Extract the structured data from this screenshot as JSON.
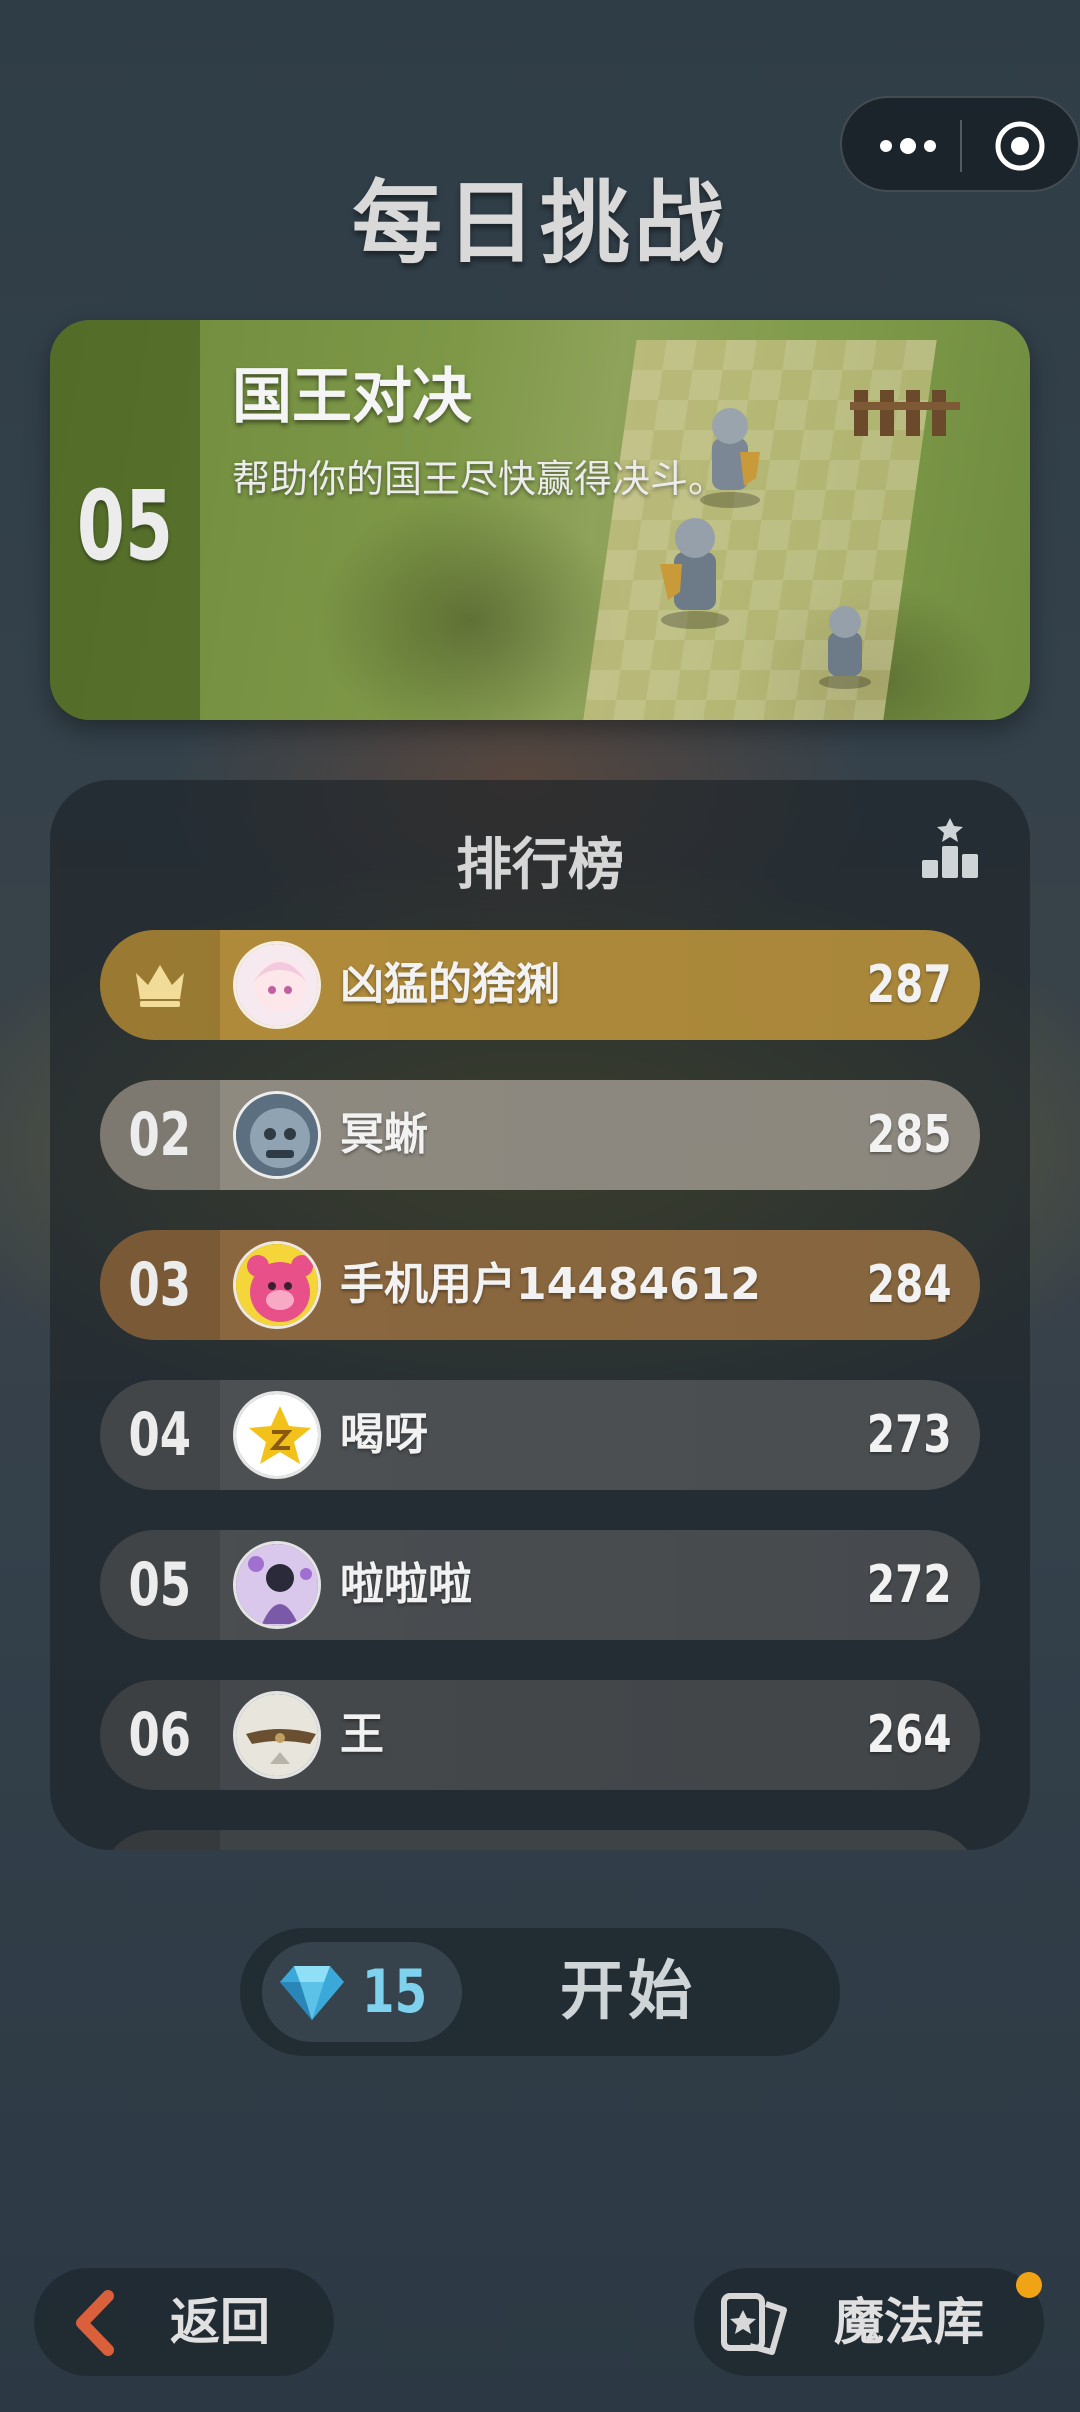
{
  "header": {
    "title": "每日挑战"
  },
  "challenge": {
    "number": "05",
    "name": "国王对决",
    "description": "帮助你的国王尽快赢得决斗。"
  },
  "leaderboard": {
    "title": "排行榜",
    "rows": [
      {
        "rank": "",
        "name": "凶猛的猞猁",
        "score": "287"
      },
      {
        "rank": "02",
        "name": "冥蜥",
        "score": "285"
      },
      {
        "rank": "03",
        "name": "手机用户14484612",
        "score": "284"
      },
      {
        "rank": "04",
        "name": "喝呀",
        "score": "273"
      },
      {
        "rank": "05",
        "name": "啦啦啦",
        "score": "272"
      },
      {
        "rank": "06",
        "name": "王",
        "score": "264"
      }
    ]
  },
  "start": {
    "gem_count": "15",
    "label": "开始"
  },
  "footer": {
    "back_label": "返回",
    "magic_label": "魔法库"
  },
  "colors": {
    "gold": "#b08b3a",
    "silver": "#8f8a80",
    "bronze": "#8b673e",
    "gem": "#7fd2ee",
    "notify": "#f0a315",
    "back_chevron": "#d9603a"
  },
  "icons": {
    "capsule_more": "more-dots-icon",
    "capsule_close": "target-circle-icon",
    "leaderboard": "podium-star-icon",
    "first_place": "crown-icon",
    "currency": "diamond-gem-icon",
    "back": "chevron-left-icon",
    "magic": "cards-icon"
  }
}
